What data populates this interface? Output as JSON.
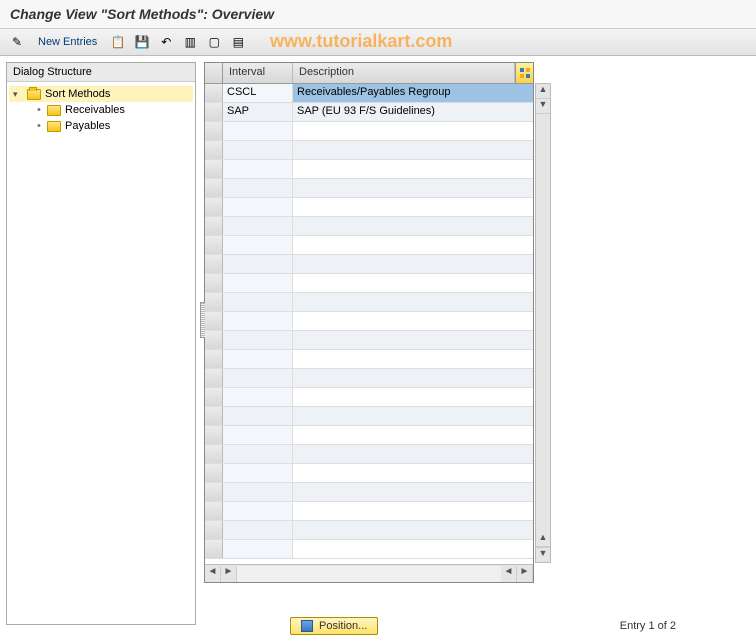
{
  "title": "Change View \"Sort Methods\": Overview",
  "toolbar": {
    "new_entries": "New Entries"
  },
  "watermark": "www.tutorialkart.com",
  "dialog_structure": {
    "header": "Dialog Structure",
    "root": "Sort Methods",
    "children": [
      "Receivables",
      "Payables"
    ]
  },
  "table": {
    "col_interval": "Interval",
    "col_description": "Description",
    "rows": [
      {
        "interval": "CSCL",
        "description": "Receivables/Payables Regroup",
        "selected": true
      },
      {
        "interval": "SAP",
        "description": "SAP (EU 93 F/S Guidelines)",
        "selected": false
      }
    ]
  },
  "footer": {
    "position": "Position...",
    "entry": "Entry 1 of 2"
  }
}
